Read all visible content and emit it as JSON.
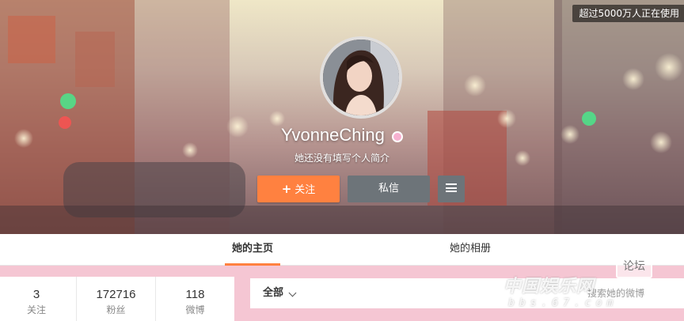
{
  "promo": {
    "text": "超过5000万人正在使用"
  },
  "profile": {
    "username": "YvonneChing",
    "gender_icon": "female-icon",
    "bio": "她还没有填写个人简介"
  },
  "actions": {
    "follow_label": "关注",
    "follow_icon": "plus-icon",
    "message_label": "私信",
    "more_icon": "menu-icon"
  },
  "tabs": [
    {
      "label": "她的主页",
      "active": true
    },
    {
      "label": "她的相册",
      "active": false
    }
  ],
  "stats": [
    {
      "value": "3",
      "label": "关注"
    },
    {
      "value": "172716",
      "label": "粉丝"
    },
    {
      "value": "118",
      "label": "微博"
    }
  ],
  "feed": {
    "filter_label": "全部",
    "search_placeholder": "搜索她的微博"
  },
  "watermark": {
    "title": "中国娱乐网",
    "url": "bbs.67.com",
    "badge": "论坛"
  },
  "colors": {
    "accent": "#ff8140",
    "button_gray": "#6d7479",
    "page_bg": "#f5c6d3"
  }
}
